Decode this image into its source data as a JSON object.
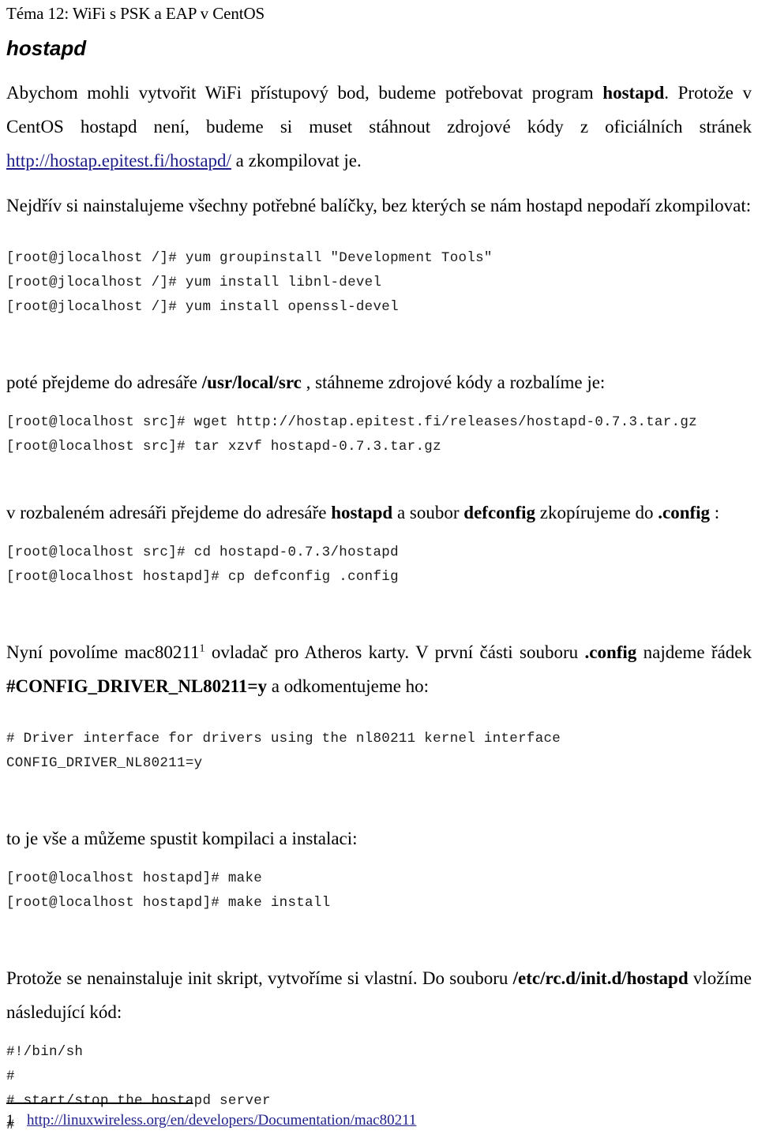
{
  "document": {
    "running_header": "Téma 12: WiFi s PSK a EAP v CentOS",
    "section_title": "hostapd"
  },
  "colors": {
    "link": "#1f1f8c",
    "text": "#000000",
    "code_text": "#1a1a1a",
    "background": "#ffffff"
  },
  "paragraphs": {
    "intro_part1": "Abychom mohli vytvořit WiFi přístupový bod, budeme potřebovat program ",
    "intro_bold1": "hostapd",
    "intro_part2": ". Protože v CentOS hostapd není, budeme si muset stáhnout zdrojové kódy z oficiálních stránek ",
    "intro_link": "http://hostap.epitest.fi/hostapd/",
    "intro_part3": " a zkompilovat je.",
    "packages": "Nejdřív si nainstalujeme všechny potřebné balíčky, bez kterých se nám hostapd nepodaří zkompilovat:",
    "srcdir_part1": "poté přejdeme do adresáře ",
    "srcdir_bold": "/usr/local/src",
    "srcdir_part2": " , stáhneme zdrojové kódy a rozbalíme je:",
    "defconfig_part1": "v rozbaleném adresáři přejdeme do adresáře ",
    "defconfig_bold1": "hostapd",
    "defconfig_part2": " a soubor ",
    "defconfig_bold2": "defconfig",
    "defconfig_part3": " zkopírujeme do ",
    "defconfig_bold3": ".config",
    "defconfig_part4": " :",
    "mac80211_part1": "Nyní povolíme mac80211",
    "mac80211_sup": "1",
    "mac80211_part2": " ovladač pro Atheros karty. V první části souboru ",
    "mac80211_bold1": ".config",
    "mac80211_part3": " najdeme řádek ",
    "mac80211_bold2": "#CONFIG_DRIVER_NL80211=y",
    "mac80211_part4": " a odkomentujeme ho:",
    "compile": "to je vše a můžeme spustit kompilaci a instalaci:",
    "initscript_part1": "Protože se nenainstaluje init skript, vytvoříme si vlastní. Do souboru ",
    "initscript_bold": "/etc/rc.d/init.d/hostapd",
    "initscript_part2": " vložíme následující kód:"
  },
  "code_blocks": {
    "install_packages": [
      "[root@jlocalhost /]# yum groupinstall \"Development Tools\"",
      "[root@jlocalhost /]# yum install libnl-devel",
      "[root@jlocalhost /]# yum install openssl-devel"
    ],
    "download_extract": [
      "[root@localhost src]# wget http://hostap.epitest.fi/releases/hostapd-0.7.3.tar.gz",
      "[root@localhost src]# tar xzvf hostapd-0.7.3.tar.gz"
    ],
    "copy_defconfig": [
      "[root@localhost src]# cd hostapd-0.7.3/hostapd",
      "[root@localhost hostapd]# cp defconfig .config"
    ],
    "driver_config": [
      "# Driver interface for drivers using the nl80211 kernel interface",
      "CONFIG_DRIVER_NL80211=y"
    ],
    "make": [
      "[root@localhost hostapd]# make",
      "[root@localhost hostapd]# make install"
    ],
    "init_script": [
      "#!/bin/sh",
      "#",
      "# start/stop the hostapd server",
      "#"
    ]
  },
  "footnote": {
    "number": "1",
    "url": "http://linuxwireless.org/en/developers/Documentation/mac80211"
  }
}
